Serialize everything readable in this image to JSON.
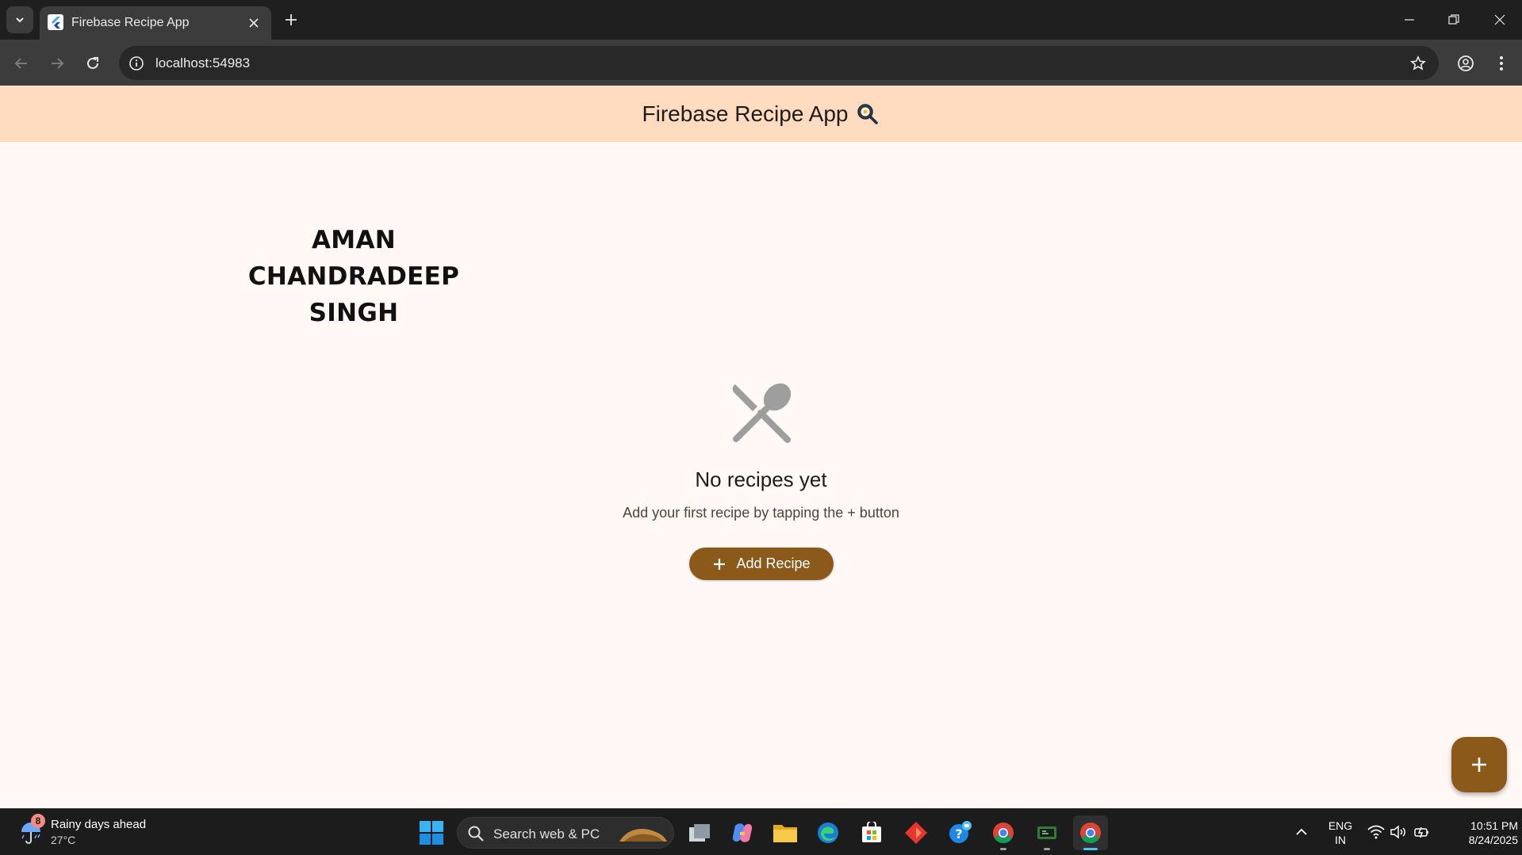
{
  "browser": {
    "tab_title": "Firebase Recipe App",
    "url": "localhost:54983"
  },
  "app": {
    "title": "Firebase Recipe App",
    "title_emoji_icon": "frying-pan-icon",
    "name_lines": [
      "AMAN",
      "CHANDRADEEP",
      "SINGH"
    ],
    "empty_state": {
      "icon": "utensils-crossed-icon",
      "title": "No recipes yet",
      "subtitle": "Add your first recipe by tapping the + button"
    },
    "add_button_label": "Add Recipe",
    "colors": {
      "appbar": "#ffdbc0",
      "background": "#fff8f5",
      "primary_button": "#8b5a1b"
    }
  },
  "taskbar": {
    "weather_text": "Rainy days ahead",
    "weather_temp": "27°C",
    "weather_badge": "8",
    "search_placeholder": "Search web & PC",
    "lang_line1": "ENG",
    "lang_line2": "IN",
    "time": "10:51 PM",
    "date": "8/24/2025"
  }
}
